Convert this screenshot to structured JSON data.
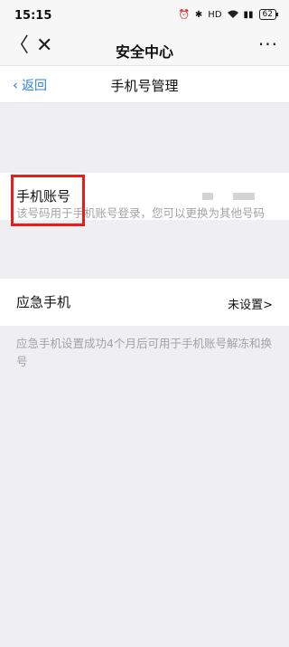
{
  "status_bar": {
    "time": "15:15",
    "battery": "62"
  },
  "app_bar": {
    "title": "安全中心",
    "more": "···"
  },
  "sub_header": {
    "return_label": "返回",
    "title": "手机号管理"
  },
  "phone_row": {
    "label": "手机账号"
  },
  "phone_note": "该号码用于手机账号登录，您可以更换为其他号码",
  "emergency_row": {
    "label": "应急手机",
    "value": "未设置>"
  },
  "emergency_note": "应急手机设置成功4个月后可用于手机账号解冻和换号"
}
